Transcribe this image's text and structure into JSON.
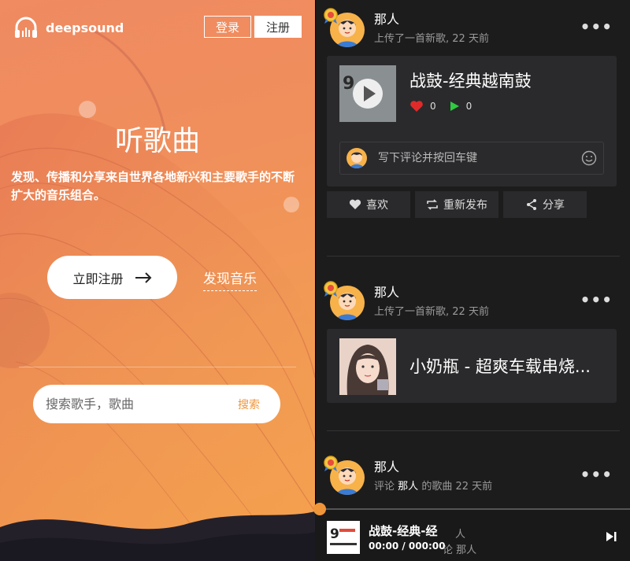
{
  "header": {
    "logo_text": "deepsound",
    "login_label": "登录",
    "register_label": "注册"
  },
  "hero": {
    "title": "听歌曲",
    "description": "发现、传播和分享来自世界各地新兴和主要歌手的不断扩大的音乐组合。",
    "cta_label": "立即注册",
    "discover_label": "发现音乐",
    "search_placeholder": "搜索歌手，歌曲",
    "search_button": "搜索"
  },
  "feed": {
    "posts": [
      {
        "user": "那人",
        "activity": "上传了一首新歌,",
        "time": "22 天前",
        "song_title": "战鼓-经典越南鼓",
        "likes": "0",
        "plays": "0",
        "comment_placeholder": "写下评论并按回车键",
        "actions": {
          "like": "喜欢",
          "repost": "重新发布",
          "share": "分享"
        }
      },
      {
        "user": "那人",
        "activity": "上传了一首新歌,",
        "time": "22 天前",
        "song_title": "小奶瓶 - 超爽车载串烧..."
      },
      {
        "user": "那人",
        "activity_prefix": "评论",
        "activity_user": "那人",
        "activity_suffix": "的歌曲",
        "time": "22 天前"
      }
    ]
  },
  "player": {
    "title": "战鼓-经典-经",
    "time": "00:00 / 000:00",
    "ghost_text_1": "人",
    "ghost_text_2": "论 那人"
  },
  "colors": {
    "accent": "#f0953a",
    "like": "#e02a2a",
    "play": "#2ecc40"
  }
}
